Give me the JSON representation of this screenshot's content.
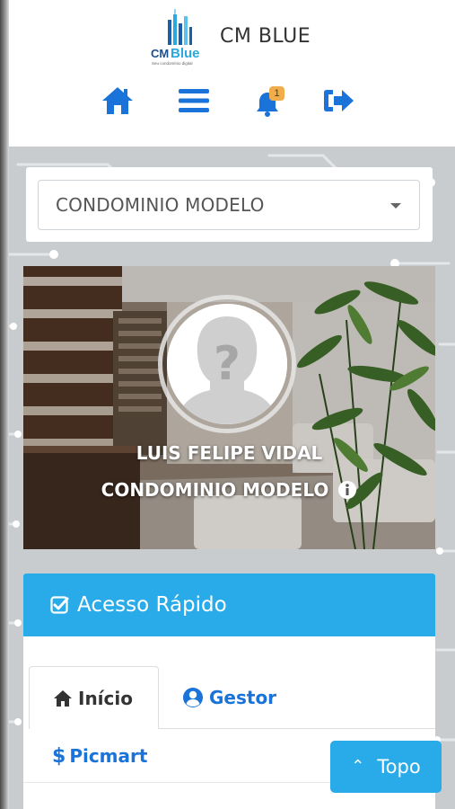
{
  "brand": {
    "name": "CM BLUE",
    "logo_text_cm": "CM",
    "logo_text_blue": "Blue",
    "logo_tagline": "Seu condomínio digital"
  },
  "nav": {
    "home_icon": "home-icon",
    "menu_icon": "bars-icon",
    "notifications_icon": "bell-icon",
    "notifications_count": "1",
    "logout_icon": "sign-out-icon"
  },
  "condo_select": {
    "selected": "CONDOMINIO MODELO"
  },
  "profile": {
    "user_name": "LUIS FELIPE VIDAL",
    "condo_name": "CONDOMINIO MODELO",
    "avatar_icon": "unknown-user-avatar",
    "info_icon": "info-circle-icon"
  },
  "quick_access": {
    "title": "Acesso Rápido",
    "tabs": [
      {
        "label": "Início",
        "icon": "home-icon",
        "active": true
      },
      {
        "label": "Gestor",
        "icon": "user-circle-icon",
        "active": false
      },
      {
        "label": "Picmart",
        "icon": "dollar-icon",
        "active": false
      }
    ]
  },
  "scroll_top": {
    "label": "Topo"
  },
  "colors": {
    "accent": "#2aabe9",
    "link": "#1a73d9",
    "badge": "#f0ad4e",
    "background": "#c9cccf"
  }
}
